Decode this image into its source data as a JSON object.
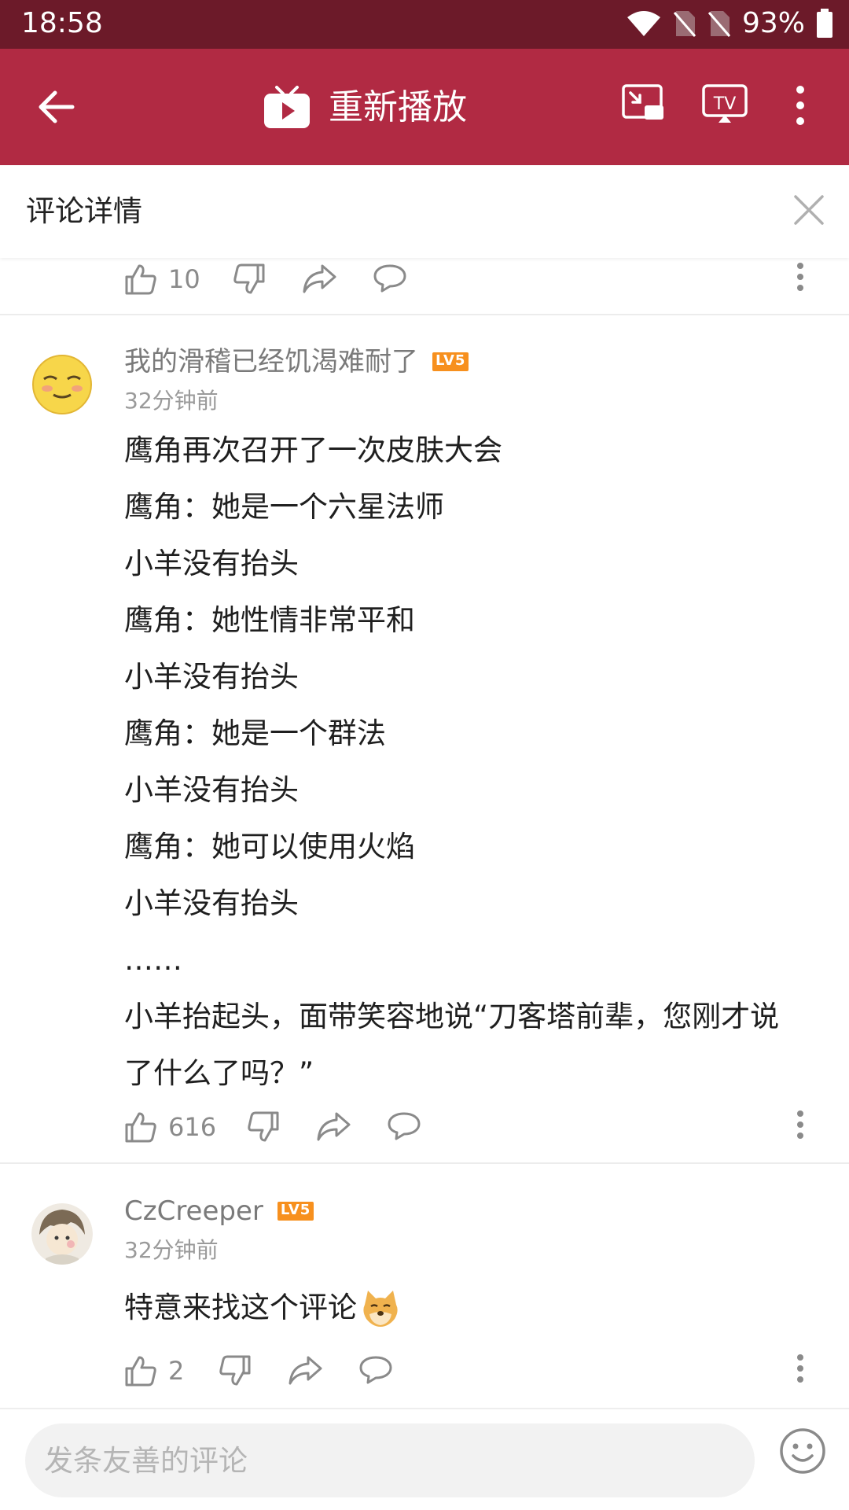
{
  "status_bar": {
    "time": "18:58",
    "battery": "93%"
  },
  "app_bar": {
    "title": "重新播放",
    "accent": "#b12a43"
  },
  "sheet": {
    "title": "评论详情"
  },
  "top_actions": {
    "like_count": "10"
  },
  "comments": [
    {
      "username": "我的滑稽已经饥渴难耐了",
      "level": "LV5",
      "time": "32分钟前",
      "lines": [
        "鹰角再次召开了一次皮肤大会",
        "鹰角：她是一个六星法师",
        "小羊没有抬头",
        "鹰角：她性情非常平和",
        "小羊没有抬头",
        "鹰角：她是一个群法",
        "小羊没有抬头",
        "鹰角：她可以使用火焰",
        "小羊没有抬头",
        "……",
        "小羊抬起头，面带笑容地说“刀客塔前辈，您刚才说",
        "了什么了吗？”"
      ],
      "like_count": "616"
    },
    {
      "username": "CzCreeper",
      "level": "LV5",
      "time": "32分钟前",
      "text": "特意来找这个评论",
      "like_count": "2"
    }
  ],
  "input": {
    "placeholder": "发条友善的评论"
  }
}
